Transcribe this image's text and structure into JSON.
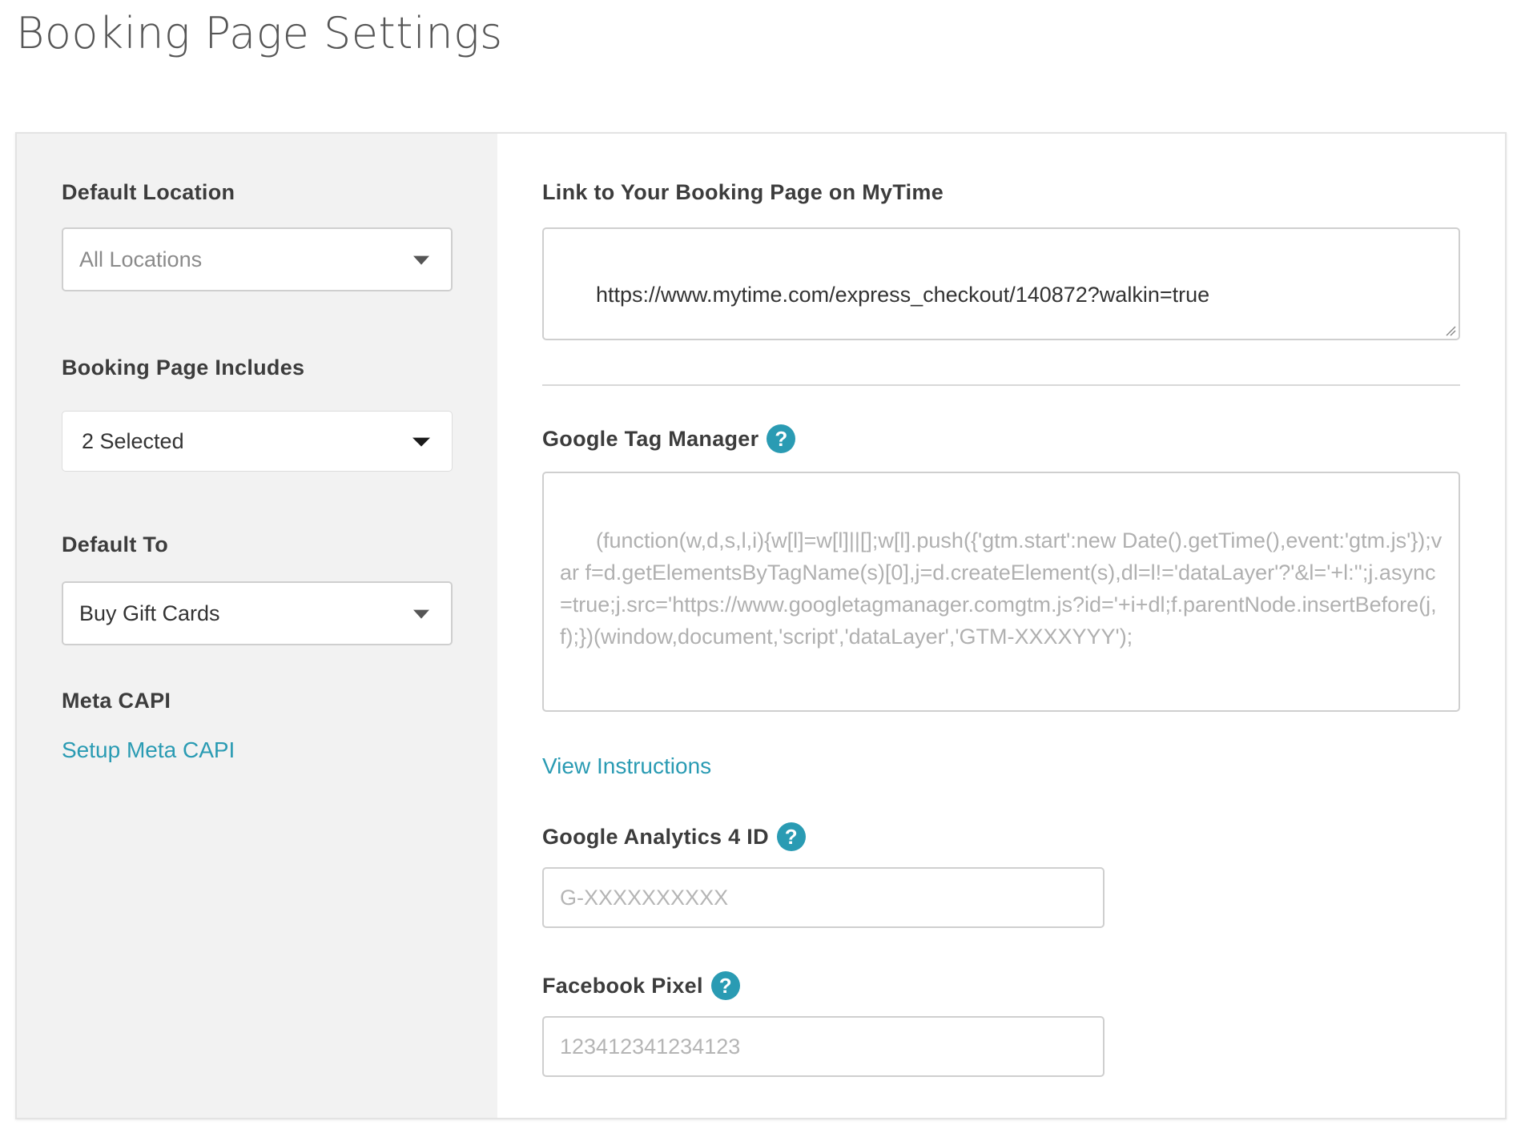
{
  "page": {
    "title": "Booking Page Settings"
  },
  "sidebar": {
    "default_location": {
      "label": "Default Location",
      "value": "All Locations"
    },
    "booking_page_includes": {
      "label": "Booking Page Includes",
      "value": "2 Selected"
    },
    "default_to": {
      "label": "Default To",
      "value": "Buy Gift Cards"
    },
    "meta_capi": {
      "label": "Meta CAPI",
      "link": "Setup Meta CAPI"
    }
  },
  "main": {
    "booking_link": {
      "label": "Link to Your Booking Page on MyTime",
      "value": "https://www.mytime.com/express_checkout/140872?walkin=true"
    },
    "gtm": {
      "label": "Google Tag Manager",
      "help": "?",
      "placeholder": "(function(w,d,s,l,i){w[l]=w[l]||[];w[l].push({'gtm.start':new Date().getTime(),event:'gtm.js'});var f=d.getElementsByTagName(s)[0],j=d.createElement(s),dl=l!='dataLayer'?'&l='+l:'';j.async=true;j.src='https://www.googletagmanager.comgtm.js?id='+i+dl;f.parentNode.insertBefore(j,f);})(window,document,'script','dataLayer','GTM-XXXXYYY');",
      "instructions_link": "View Instructions"
    },
    "ga4": {
      "label": "Google Analytics 4 ID",
      "help": "?",
      "placeholder": "G-XXXXXXXXXX"
    },
    "facebook_pixel": {
      "label": "Facebook Pixel",
      "help": "?",
      "placeholder": "123412341234123"
    }
  },
  "colors": {
    "accent": "#2a9bb3",
    "sidebar_bg": "#f2f2f2",
    "border": "#cfcfcf"
  },
  "icons": {
    "dropdown": "chevron-down-icon",
    "help": "help-icon",
    "resize": "resize-handle-icon"
  }
}
